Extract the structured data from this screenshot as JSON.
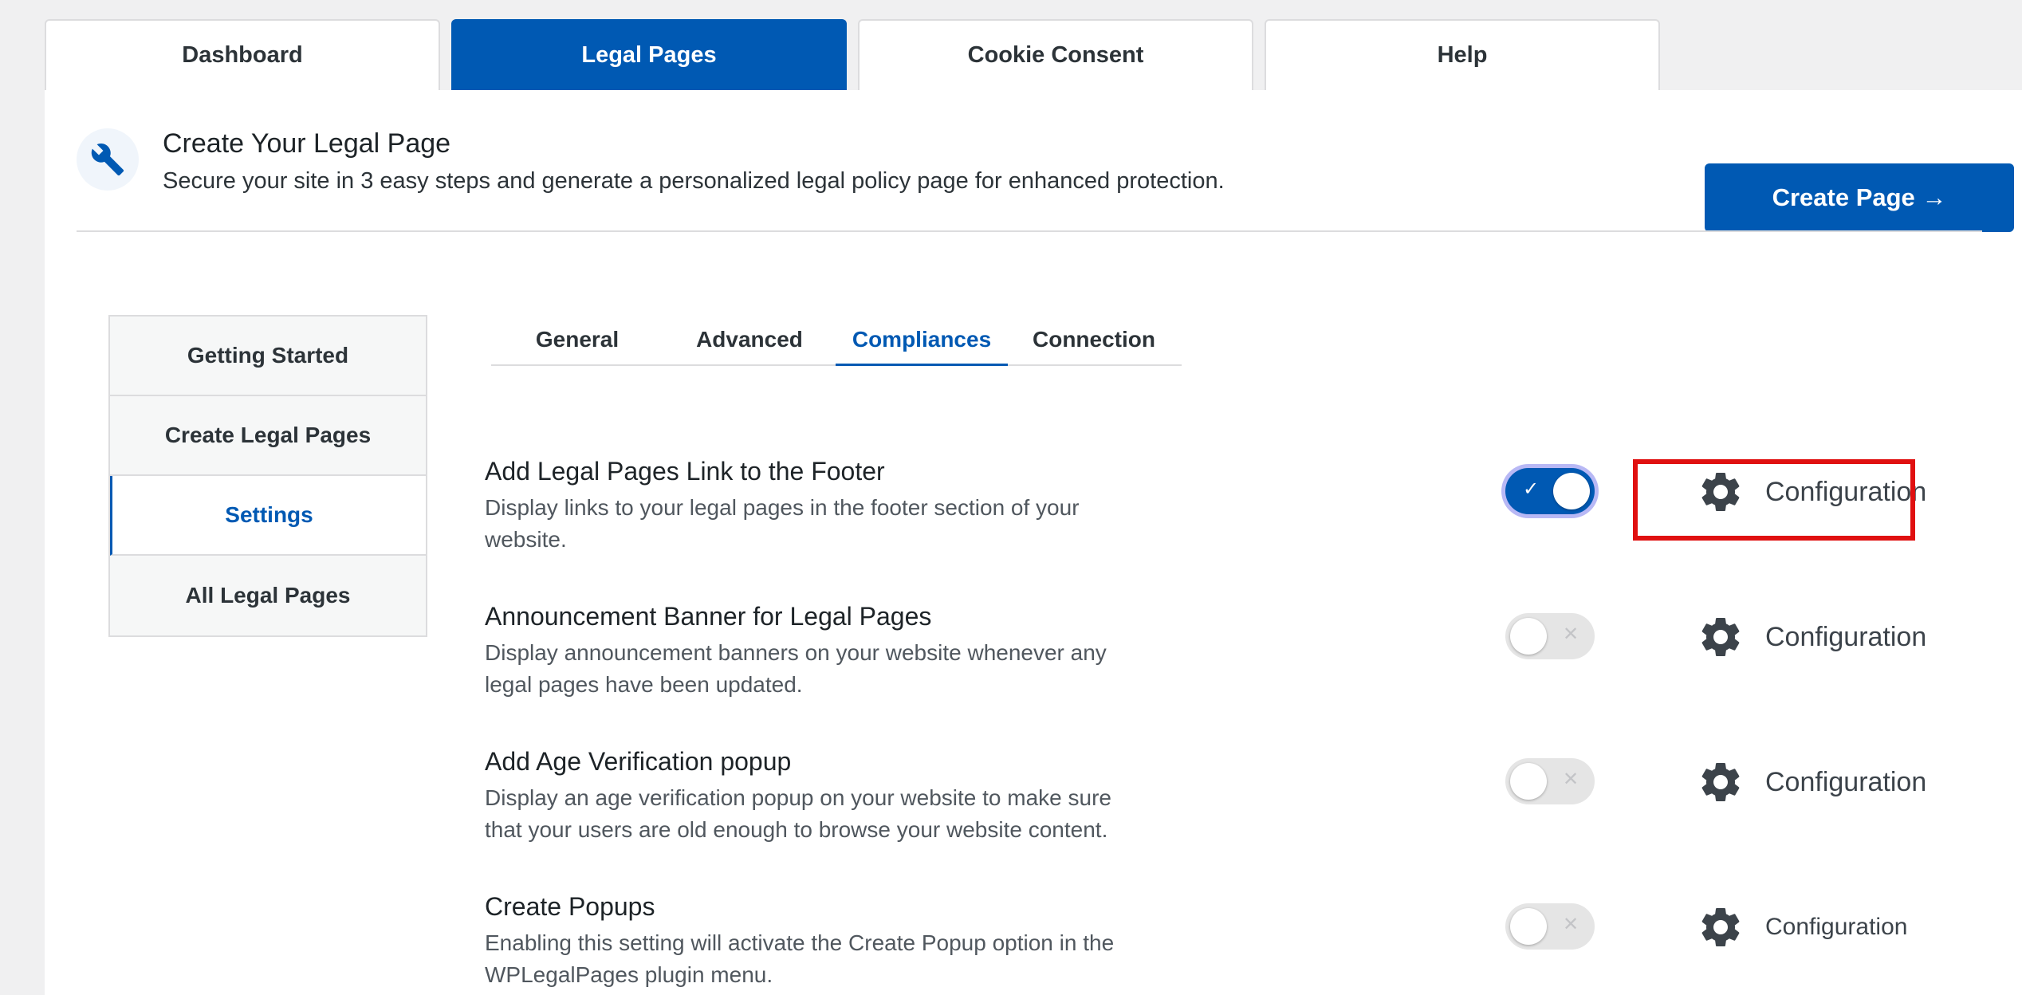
{
  "top_tabs": [
    {
      "label": "Dashboard",
      "active": false
    },
    {
      "label": "Legal Pages",
      "active": true
    },
    {
      "label": "Cookie Consent",
      "active": false
    },
    {
      "label": "Help",
      "active": false
    }
  ],
  "header": {
    "icon": "wrench-icon",
    "title": "Create Your Legal Page",
    "subtitle": "Secure your site in 3 easy steps and generate a personalized legal policy page for enhanced protection.",
    "button_label": "Create Page →"
  },
  "sidebar": {
    "items": [
      {
        "label": "Getting Started",
        "active": false
      },
      {
        "label": "Create Legal Pages",
        "active": false
      },
      {
        "label": "Settings",
        "active": true
      },
      {
        "label": "All Legal Pages",
        "active": false
      }
    ]
  },
  "sub_tabs": [
    {
      "label": "General",
      "active": false
    },
    {
      "label": "Advanced",
      "active": false
    },
    {
      "label": "Compliances",
      "active": true
    },
    {
      "label": "Connection",
      "active": false
    }
  ],
  "settings": [
    {
      "title": "Add Legal Pages Link to the Footer",
      "description": "Display links to your legal pages in the footer section of your website.",
      "enabled": true,
      "config_label": "Configuration"
    },
    {
      "title": "Announcement Banner for Legal Pages",
      "description": "Display announcement banners on your website whenever any legal pages have been updated.",
      "enabled": false,
      "config_label": "Configuration"
    },
    {
      "title": "Add Age Verification popup",
      "description": "Display an age verification popup on your website to make sure that your users are old enough to browse your website content.",
      "enabled": false,
      "config_label": "Configuration"
    },
    {
      "title": "Create Popups",
      "description": "Enabling this setting will activate the Create Popup option in the WPLegalPages plugin menu.",
      "enabled": false,
      "config_label": "Configuration"
    }
  ],
  "toggle_marks": {
    "on": "✓",
    "off": "✕"
  },
  "colors": {
    "accent": "#0059b3",
    "highlight": "#e01010"
  }
}
